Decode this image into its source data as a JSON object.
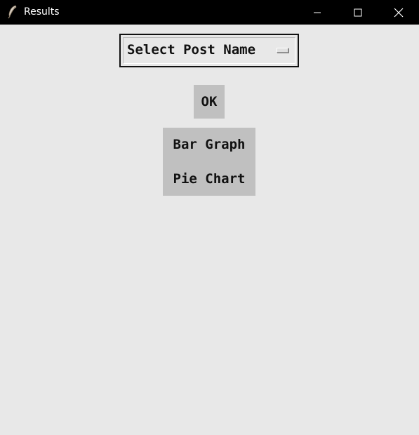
{
  "window": {
    "title": "Results",
    "icon": "feather-icon",
    "controls": {
      "minimize_icon": "minimize-icon",
      "maximize_icon": "maximize-icon",
      "close_icon": "close-icon"
    }
  },
  "dropdown": {
    "selected": "Select Post Name"
  },
  "buttons": {
    "ok_label": "OK"
  },
  "chart_menu": {
    "items": [
      {
        "label": "Bar Graph"
      },
      {
        "label": "Pie Chart"
      }
    ]
  },
  "colors": {
    "titlebar": "#000000",
    "background": "#e8e8e8",
    "button": "#c0c0c0",
    "text": "#111111"
  }
}
